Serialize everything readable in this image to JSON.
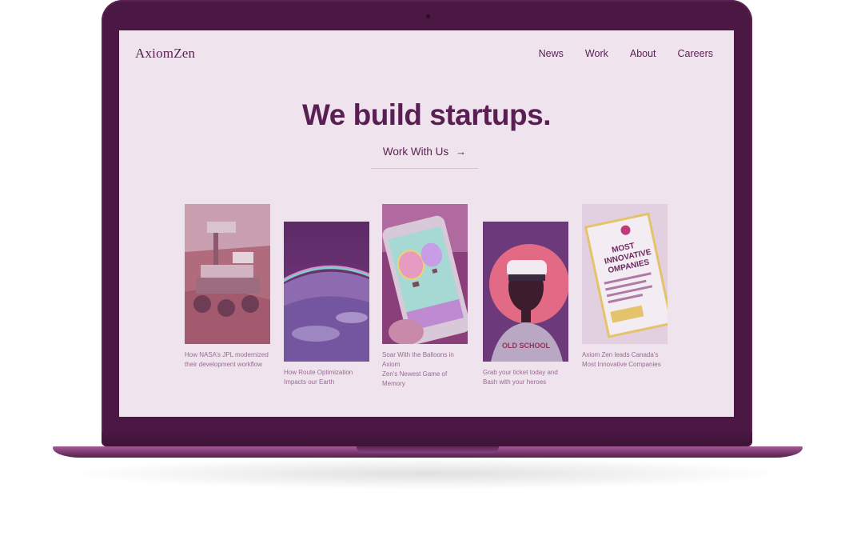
{
  "site": {
    "logo": "AxiomZen",
    "nav": [
      "News",
      "Work",
      "About",
      "Careers"
    ],
    "headline": "We build startups.",
    "cta_label": "Work With Us",
    "cta_arrow": "→"
  },
  "cards": [
    {
      "caption_line1": "How NASA’s JPL modernized",
      "caption_line2": "their development workflow",
      "image": "mars-rover"
    },
    {
      "caption_line1": "How Route Optimization",
      "caption_line2": "Impacts our Earth",
      "image": "earth-from-space"
    },
    {
      "caption_line1": "Soar With the Balloons in Axiom",
      "caption_line2": "Zen’s Newest Game of Memory",
      "image": "phone-balloons"
    },
    {
      "caption_line1": "Grab your ticket today and",
      "caption_line2": "Bash with your heroes",
      "image": "vr-headset"
    },
    {
      "caption_line1": "Axiom Zen leads Canada’s",
      "caption_line2": "Most Innovative Companies",
      "image": "magazine"
    }
  ],
  "magazine_text": {
    "line1": "MOST",
    "line2": "INNOVATIVE",
    "line3": "OMPANIES"
  },
  "shirt_text": "OLD SCHOOL",
  "colors": {
    "device": "#4a1842",
    "screen_bg": "#efe3ee",
    "brand_text": "#5a1f52",
    "caption": "#9a6a92"
  }
}
